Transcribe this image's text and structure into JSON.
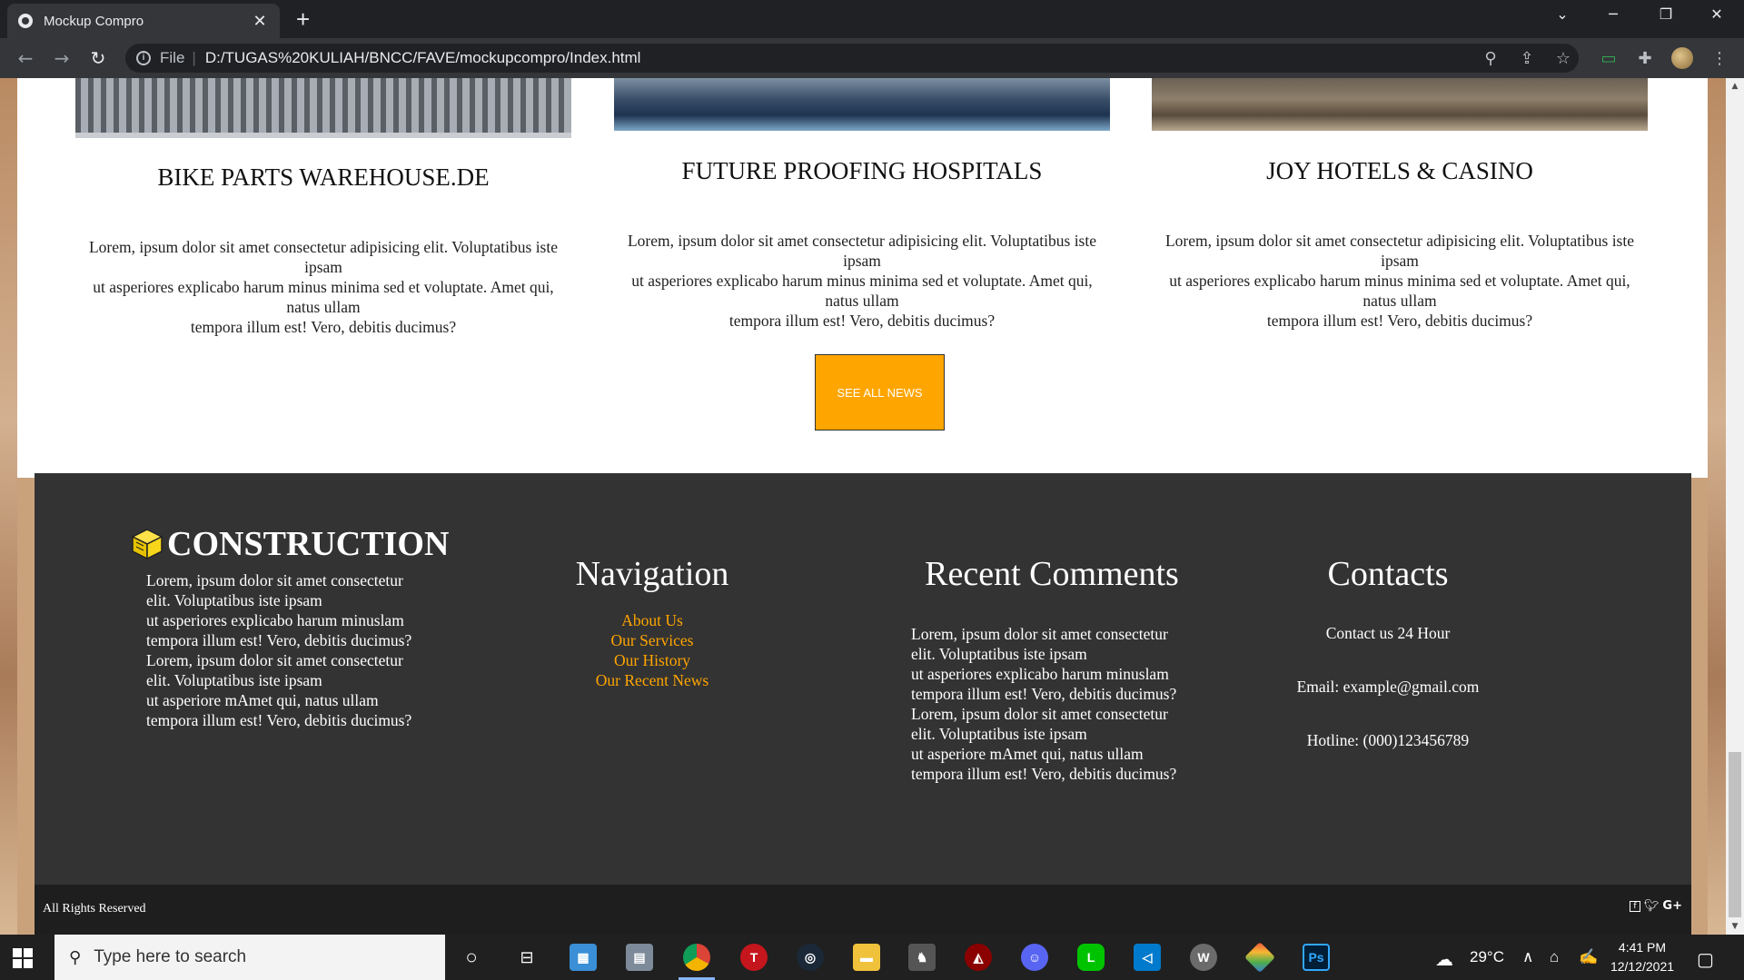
{
  "browser": {
    "tab_title": "Mockup Compro",
    "tab_close": "✕",
    "new_tab": "+",
    "url_scheme_label": "File",
    "url": "D:/TUGAS%20KULIAH/BNCC/FAVE/mockupcompro/Index.html",
    "icons": [
      "back-icon",
      "forward-icon",
      "reload-icon",
      "info-icon",
      "zoom-icon",
      "share-icon",
      "star-icon",
      "extension-icon",
      "puzzle-icon",
      "profile-avatar",
      "menu-icon"
    ]
  },
  "news": [
    {
      "title": "BIKE PARTS WAREHOUSE.DE",
      "text_lines": [
        "Lorem, ipsum dolor sit amet consectetur adipisicing elit. Voluptatibus iste ipsam",
        "ut asperiores explicabo harum minus minima sed et voluptate. Amet qui, natus ullam",
        "tempora illum est! Vero, debitis ducimus?"
      ]
    },
    {
      "title": "FUTURE PROOFING HOSPITALS",
      "text_lines": [
        "Lorem, ipsum dolor sit amet consectetur adipisicing elit. Voluptatibus iste ipsam",
        "ut asperiores explicabo harum minus minima sed et voluptate. Amet qui, natus ullam",
        "tempora illum est! Vero, debitis ducimus?"
      ]
    },
    {
      "title": "JOY HOTELS & CASINO",
      "text_lines": [
        "Lorem, ipsum dolor sit amet consectetur adipisicing elit. Voluptatibus iste ipsam",
        "ut asperiores explicabo harum minus minima sed et voluptate. Amet qui, natus ullam",
        "tempora illum est! Vero, debitis ducimus?"
      ]
    }
  ],
  "see_all_label": "SEE ALL NEWS",
  "footer": {
    "brand": "CONSTRUCTION",
    "about_text": "Lorem, ipsum dolor sit amet consectetur\nelit. Voluptatibus iste ipsam\nut asperiores explicabo harum minuslam\ntempora illum est! Vero, debitis ducimus?\nLorem, ipsum dolor sit amet consectetur\nelit. Voluptatibus iste ipsam\nut asperiore mAmet qui, natus ullam\ntempora illum est! Vero, debitis ducimus?",
    "navigation_heading": "Navigation",
    "nav_links": [
      "About Us",
      "Our Services",
      "Our History",
      "Our Recent News"
    ],
    "comments_heading": "Recent Comments",
    "comments_text": "Lorem, ipsum dolor sit amet consectetur\nelit. Voluptatibus iste ipsam\nut asperiores explicabo harum minuslam\ntempora illum est! Vero, debitis ducimus?\nLorem, ipsum dolor sit amet consectetur\nelit. Voluptatibus iste ipsam\nut asperiore mAmet qui, natus ullam\ntempora illum est! Vero, debitis ducimus?",
    "contacts_heading": "Contacts",
    "contact_hours": "Contact us 24 Hour",
    "contact_email": "Email: example@gmail.com",
    "contact_hotline": "Hotline: (000)123456789",
    "rights": "All Rights Reserved",
    "social_icons": [
      "facebook-icon",
      "twitter-icon",
      "google-plus-icon"
    ],
    "social_gplus": "G+"
  },
  "taskbar": {
    "search_placeholder": "Type here to search",
    "weather": "29°C",
    "time": "4:41 PM",
    "date": "12/12/2021",
    "apps": [
      "task-view",
      "widgets",
      "explorer-app",
      "chrome",
      "t-app",
      "steam",
      "file-explorer",
      "game-app",
      "car-app",
      "discord",
      "line",
      "vscode",
      "w-app",
      "git-app",
      "photoshop"
    ],
    "accent": "#8ab4f8"
  },
  "colors": {
    "accent_orange": "#ffa500",
    "footer_bg": "#333333",
    "footer_bottom_bg": "#1e1e1e"
  }
}
